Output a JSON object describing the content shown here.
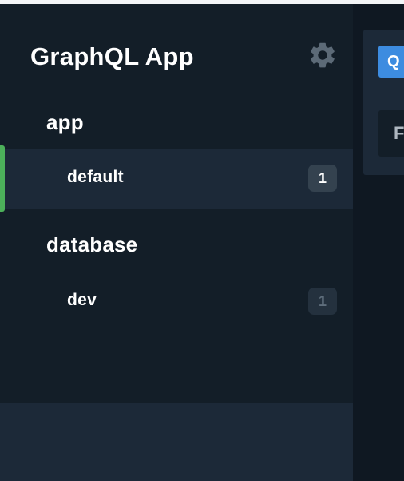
{
  "sidebar": {
    "title": "GraphQL App",
    "settings_icon": "gear-icon",
    "sections": [
      {
        "heading": "app",
        "items": [
          {
            "label": "default",
            "count": "1",
            "active": true
          }
        ]
      },
      {
        "heading": "database",
        "items": [
          {
            "label": "dev",
            "count": "1",
            "active": false
          }
        ]
      }
    ]
  },
  "main": {
    "tab_label_partial": "Q",
    "field_label_partial": "F"
  },
  "colors": {
    "background": "#131e28",
    "active_row": "#1c2938",
    "active_indicator": "#4cb05a",
    "accent_blue": "#3d8ce0"
  }
}
